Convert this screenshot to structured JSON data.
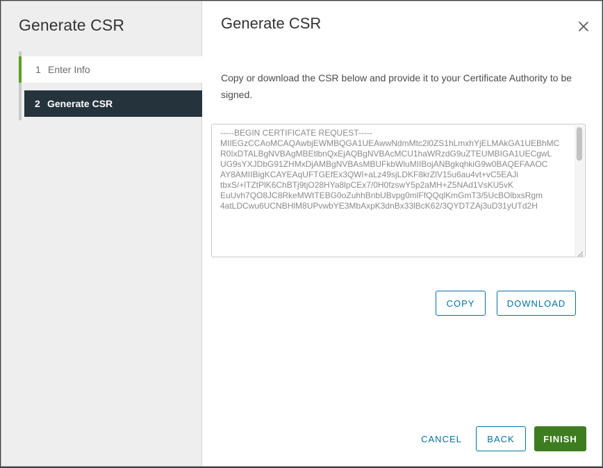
{
  "wizard": {
    "title": "Generate CSR",
    "steps": [
      {
        "number": "1",
        "label": "Enter Info",
        "state": "completed"
      },
      {
        "number": "2",
        "label": "Generate CSR",
        "state": "active"
      }
    ]
  },
  "page": {
    "title": "Generate CSR",
    "close_icon": "close-icon",
    "instructions": "Copy or download the CSR below and provide it to your Certificate Authority to be signed.",
    "csr_value": "-----BEGIN CERTIFICATE REQUEST-----\nMIIEGzCCAoMCAQAwbjEWMBQGA1UEAwwNdmMtc2l0ZS1hLmxhYjELMAkGA1UEBhMC\nR0IxDTALBgNVBAgMBEtlbnQxEjAQBgNVBAcMCU1haWRzdG9uZTEUMBIGA1UECgwL\nUG9sYXJDbG91ZHMxDjAMBgNVBAsMBUFkbWluMIIBojANBgkqhkiG9w0BAQEFAAOC\nAY8AMIIBigKCAYEAqUFTGEfEx3QWl+aLz49sjLDKF8krZlV15u6au4vt+vC5EAJi\ntbxS/+lTZtPlK6ChBTj9tjO28HYa8lpCEx7/0H0fzswY5p2aMH+Z5NAd1VsKU5vK\nEuUvh7QO8JC8RkeMWtTEBG0oZuhhBnbUBvpg0mlFfQQqlKmGmT3/5UcBOlbxsRgm\n4atLDCwu6UCNBHlM8UPvwbYE3MbAxpK3dnBx33lBcK62/3QYDTZAj3uD31yUTd2H"
  },
  "actions": {
    "copy": "COPY",
    "download": "DOWNLOAD",
    "cancel": "CANCEL",
    "back": "BACK",
    "finish": "FINISH"
  },
  "colors": {
    "accent": "#0072a3",
    "primary_button": "#3d7d1f",
    "active_step_bg": "#25333d",
    "completed_step_marker": "#5aa220"
  }
}
